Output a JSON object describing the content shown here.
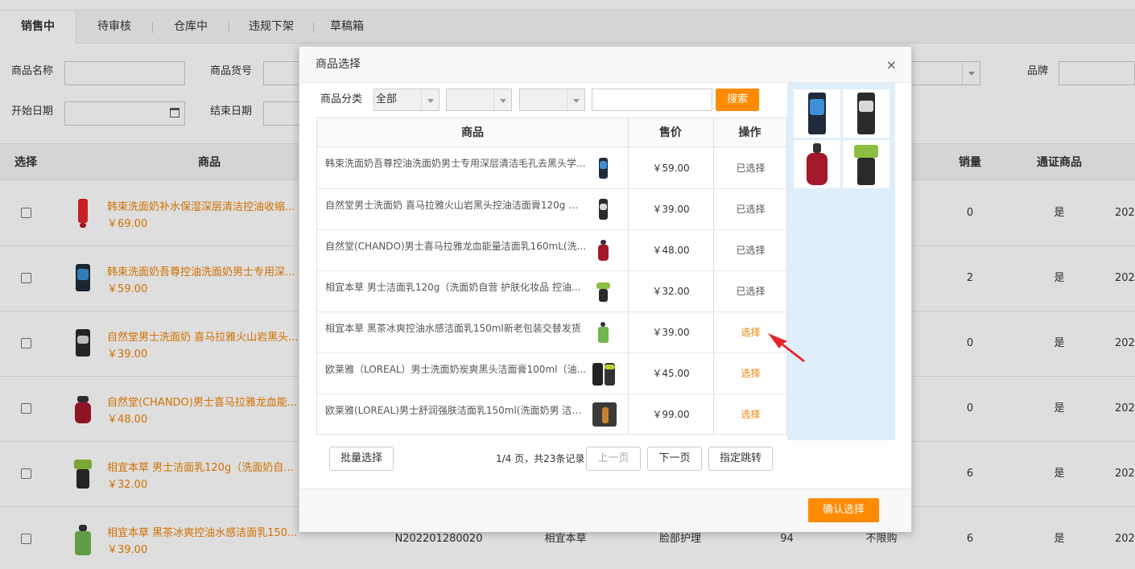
{
  "tabs": [
    "销售中",
    "待审核",
    "仓库中",
    "违规下架",
    "草稿箱"
  ],
  "filters": {
    "name_label": "商品名称",
    "code_label": "商品货号",
    "brand_label": "品牌",
    "start_label": "开始日期",
    "end_label": "结束日期"
  },
  "bg_table": {
    "headers": {
      "select": "选择",
      "product": "商品",
      "sales": "销量",
      "general": "通证商品"
    },
    "rows": [
      {
        "name": "韩束洗面奶补水保湿深层清洁控油收缩...",
        "price": "￥69.00",
        "sales": "0",
        "general": "是",
        "date": "202"
      },
      {
        "name": "韩束洗面奶吾尊控油洗面奶男士专用深...",
        "price": "￥59.00",
        "sales": "2",
        "general": "是",
        "date": "202"
      },
      {
        "name": "自然堂男士洗面奶 喜马拉雅火山岩黑头...",
        "price": "￥39.00",
        "sales": "0",
        "general": "是",
        "date": "202"
      },
      {
        "name": "自然堂(CHANDO)男士喜马拉雅龙血能...",
        "price": "￥48.00",
        "sales": "0",
        "general": "是",
        "date": "202"
      },
      {
        "name": "相宜本草 男士洁面乳120g（洗面奶自...",
        "price": "￥32.00",
        "sales": "6",
        "general": "是",
        "date": "202"
      },
      {
        "name": "相宜本草 黑茶冰爽控油水感洁面乳150...",
        "price": "￥39.00",
        "sales": "6",
        "general": "是",
        "date": "202",
        "code": "N202201280020",
        "brand": "相宜本草",
        "category": "脸部护理",
        "stock": "94",
        "limit": "不限购"
      }
    ]
  },
  "modal": {
    "title": "商品选择",
    "close": "×",
    "category_label": "商品分类",
    "category_value": "全部",
    "search_button": "搜索",
    "headers": {
      "product": "商品",
      "price": "售价",
      "action": "操作"
    },
    "rows": [
      {
        "name": "韩束洗面奶吾尊控油洗面奶男士专用深层清洁毛孔去黑头学...",
        "price": "￥59.00",
        "action": "已选择",
        "active": false
      },
      {
        "name": "自然堂男士洗面奶 喜马拉雅火山岩黑头控油洁面膏120g 洗...",
        "price": "￥39.00",
        "action": "已选择",
        "active": false
      },
      {
        "name": "自然堂(CHANDO)男士喜马拉雅龙血能量洁面乳160mL(洗...",
        "price": "￥48.00",
        "action": "已选择",
        "active": false
      },
      {
        "name": "相宜本草 男士洁面乳120g（洗面奶自营 护肤化妆品 控油...",
        "price": "￥32.00",
        "action": "已选择",
        "active": false
      },
      {
        "name": "相宜本草 黑茶冰爽控油水感洁面乳150ml新老包装交替发货",
        "price": "￥39.00",
        "action": "选择",
        "active": true
      },
      {
        "name": "欧莱雅（LOREAL）男士洗面奶炭爽黑头洁面膏100ml（油...",
        "price": "￥45.00",
        "action": "选择",
        "active": true
      },
      {
        "name": "欧莱雅(LOREAL)男士舒润强肤洁面乳150ml(洗面奶男 洁面...",
        "price": "￥99.00",
        "action": "选择",
        "active": true
      }
    ],
    "batch_button": "批量选择",
    "pager_info": "1/4 页，共23条记录",
    "prev_button": "上一页",
    "next_button": "下一页",
    "jump_button": "指定跳转",
    "confirm_button": "确认选择"
  },
  "colors": {
    "accent": "#ff8c00",
    "link": "#f08200",
    "side_panel": "#deeefb"
  }
}
